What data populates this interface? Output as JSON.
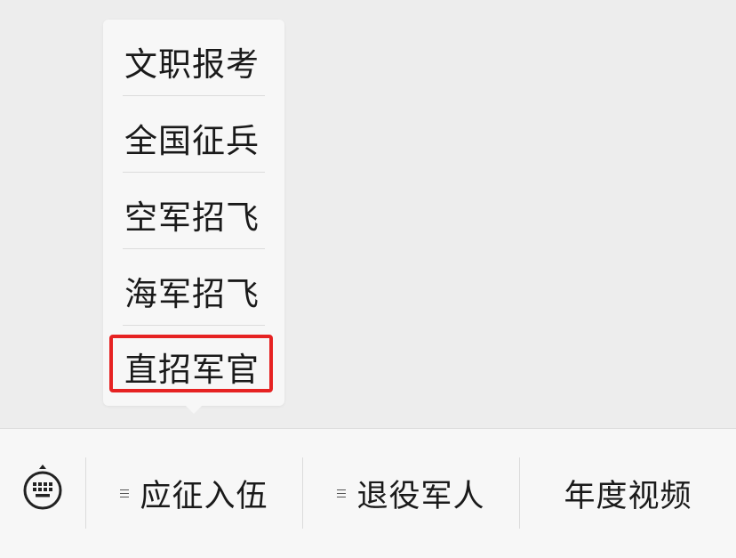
{
  "popup_menu": {
    "items": [
      {
        "label": "文职报考"
      },
      {
        "label": "全国征兵"
      },
      {
        "label": "空军招飞"
      },
      {
        "label": "海军招飞"
      },
      {
        "label": "直招军官"
      }
    ]
  },
  "bottom_bar": {
    "keyboard_icon": "keyboard-icon",
    "tabs": [
      {
        "label": "应征入伍",
        "has_menu_icon": true
      },
      {
        "label": "退役军人",
        "has_menu_icon": true
      },
      {
        "label": "年度视频",
        "has_menu_icon": false
      }
    ]
  },
  "colors": {
    "highlight": "#e62222",
    "background": "#ededed",
    "bar": "#f7f7f7"
  }
}
